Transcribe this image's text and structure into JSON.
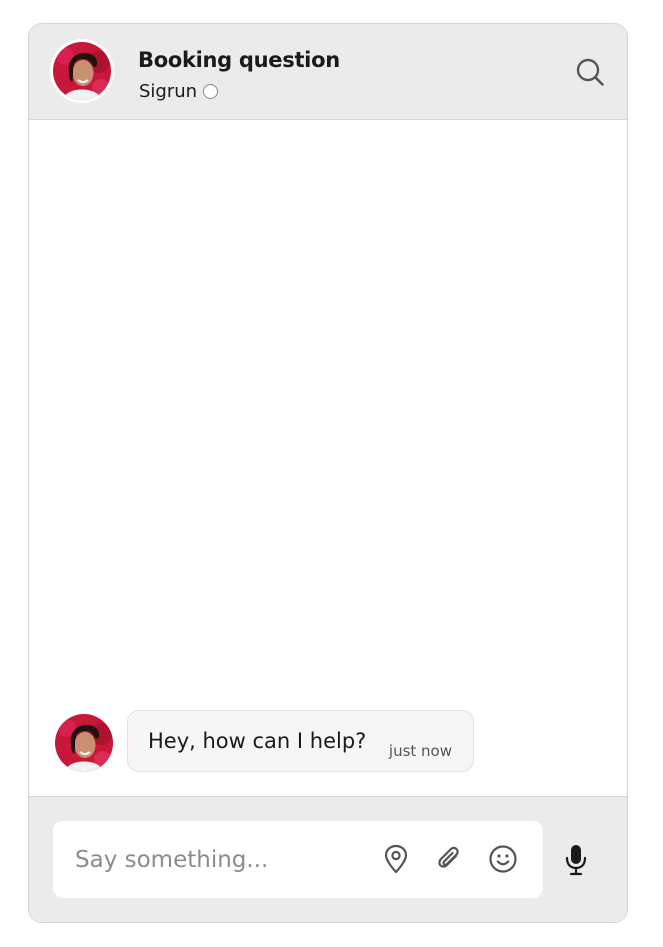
{
  "header": {
    "title": "Booking question",
    "agent_name": "Sigrun",
    "avatar_icon": "agent-avatar",
    "status_icon": "offline-status-indicator",
    "search_icon": "search-icon"
  },
  "messages": [
    {
      "text": "Hey, how can I help?",
      "time": "just now",
      "avatar_icon": "agent-avatar"
    }
  ],
  "composer": {
    "placeholder": "Say something...",
    "location_icon": "location-pin-icon",
    "attach_icon": "paperclip-icon",
    "emoji_icon": "smiley-icon",
    "mic_icon": "microphone-icon"
  },
  "colors": {
    "header_bg": "#ebebeb",
    "border": "#d4d4d4",
    "bubble_bg": "#f6f6f6",
    "avatar_bg": "#c8173a",
    "icon": "#555555"
  }
}
